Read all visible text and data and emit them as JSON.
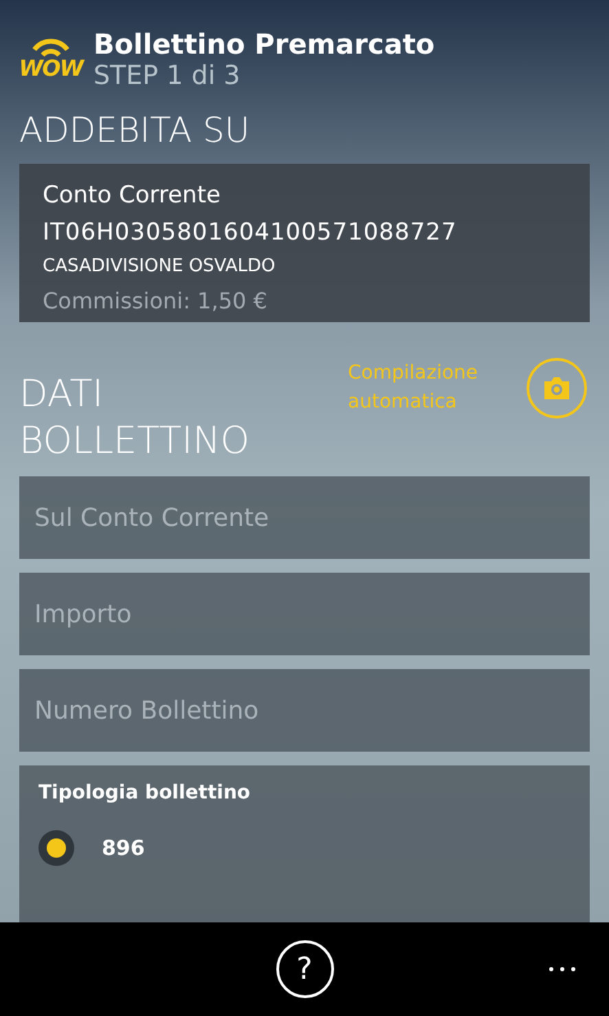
{
  "header": {
    "logo_text": "WOW",
    "title": "Bollettino Premarcato",
    "step": "STEP 1 di 3"
  },
  "debit": {
    "heading": "ADDEBITA SU",
    "account_type": "Conto Corrente",
    "iban": "IT06H0305801604100571088727",
    "holder": "CASADIVISIONE OSVALDO",
    "fee": "Commissioni: 1,50 €"
  },
  "form": {
    "heading": [
      "DATI",
      "BOLLETTINO"
    ],
    "auto_fill": "Compilazione automatica",
    "fields": [
      {
        "placeholder": "Sul Conto Corrente"
      },
      {
        "placeholder": "Importo"
      },
      {
        "placeholder": "Numero Bollettino"
      }
    ],
    "type_group": {
      "label": "Tipologia bollettino",
      "options": [
        {
          "label": "896",
          "selected": true
        }
      ]
    }
  },
  "app_bar": {
    "help_label": "?"
  }
}
